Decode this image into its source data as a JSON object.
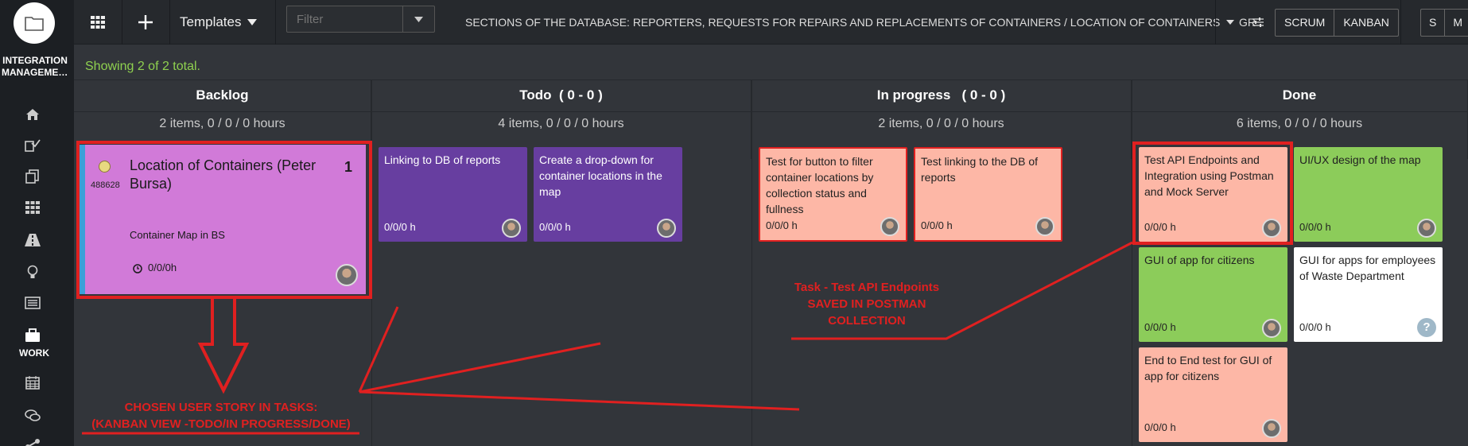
{
  "sidebar": {
    "app_name_line1": "INTEGRATION",
    "app_name_line2": "MANAGEMEN...",
    "active_label": "WORK",
    "icons": [
      "home-icon",
      "tasks-icon",
      "documents-icon",
      "grid-icon",
      "road-icon",
      "bulb-icon",
      "list-icon",
      "briefcase-icon",
      "calendar-icon",
      "chat-icon",
      "share-icon"
    ]
  },
  "topbar": {
    "templates_label": "Templates",
    "filter_placeholder": "Filter",
    "sections_label": "SECTIONS OF THE DATABASE: REPORTERS, REQUESTS FOR REPAIRS AND REPLACEMENTS OF CONTAINERS / LOCATION OF CONTAINERS",
    "gr_label": "GR",
    "scrum_label": "SCRUM",
    "kanban_label": "KANBAN",
    "s_label": "S",
    "m_label": "M"
  },
  "showing": "Showing 2 of 2 total.",
  "columns": [
    {
      "title": "Backlog",
      "summary": "2 items, 0 / 0 / 0 hours"
    },
    {
      "title": "Todo  ( 0 - 0 )",
      "summary": "4 items, 0 / 0 / 0 hours"
    },
    {
      "title": "In progress   ( 0 - 0 )",
      "summary": "2 items, 0 / 0 / 0 hours"
    },
    {
      "title": "Done",
      "summary": "6 items, 0 / 0 / 0 hours"
    }
  ],
  "story": {
    "id": "488628",
    "title": "Location of Containers (Peter Bursa)",
    "count": "1",
    "subtitle": "Container Map in BS",
    "hours": "0/0/0h"
  },
  "todo_cards": [
    {
      "title": "Linking to DB of reports",
      "hours": "0/0/0 h"
    },
    {
      "title": "Create a drop-down for container locations in the map",
      "hours": "0/0/0 h"
    }
  ],
  "inprogress_cards": [
    {
      "title": "Test for button to filter container locations by collection status and fullness",
      "hours": "0/0/0 h"
    },
    {
      "title": "Test linking to the DB of reports",
      "hours": "0/0/0 h"
    }
  ],
  "done_cards": [
    {
      "title": "Test API Endpoints and Integration using Postman and Mock Server",
      "hours": "0/0/0 h"
    },
    {
      "title": "UI/UX design of the map",
      "hours": "0/0/0 h"
    },
    {
      "title": "GUI of app for citizens",
      "hours": "0/0/0 h"
    },
    {
      "title": "GUI for apps for employees of Waste Department",
      "hours": "0/0/0 h"
    },
    {
      "title": "End to End test for GUI of app for citizens",
      "hours": "0/0/0 h"
    }
  ],
  "annotations": {
    "task_line1": "Task - Test API Endpoints",
    "task_line2": "SAVED IN POSTMAN",
    "task_line3": "COLLECTION",
    "story_line1": "CHOSEN USER STORY IN TASKS:",
    "story_line2": "(KANBAN VIEW -TODO/IN PROGRESS/DONE)"
  },
  "colors": {
    "accent_green": "#8fd14f",
    "annotation_red": "#e02020",
    "story_pink": "#d17ad8",
    "card_purple": "#673ea0",
    "card_salmon": "#fdb7a6",
    "card_green": "#8ccc5a"
  }
}
